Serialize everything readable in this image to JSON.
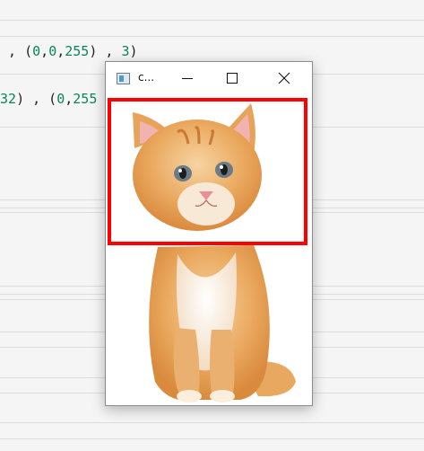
{
  "editor": {
    "line1": {
      "prefix": " , (",
      "n1": "0",
      "c1": ",",
      "n2": "0",
      "c2": ",",
      "n3": "255",
      "mid": ") , ",
      "n4": "3",
      "suffix": ")"
    },
    "line2": {
      "n0": "32",
      "mid": ") , (",
      "n1": "0",
      "c1": ",",
      "n2": "255"
    }
  },
  "window": {
    "title": "c...",
    "buttons": {
      "minimize": "minimize-icon",
      "maximize": "maximize-icon",
      "close": "close-icon"
    }
  },
  "image": {
    "description_icon": "kitten-photo",
    "rectangle_color": "#ff0000"
  },
  "colors": {
    "accent_red": "#ff0000",
    "code_number": "#098658"
  }
}
